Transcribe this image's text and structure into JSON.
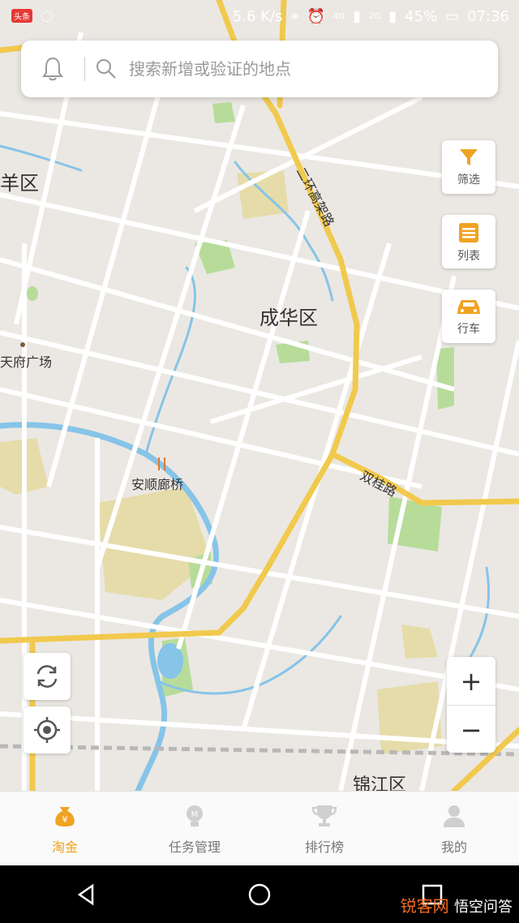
{
  "status_bar": {
    "speed": "5.6 K/s",
    "network1": "4G",
    "network2": "2G",
    "battery": "45%",
    "time": "07:36",
    "badge": "头条"
  },
  "search": {
    "placeholder": "搜索新增或验证的地点"
  },
  "map": {
    "labels": {
      "district1": "羊区",
      "district2": "成华区",
      "district3": "锦江区",
      "road1": "二环高架路",
      "road2": "双桂路",
      "poi1": "天府广场",
      "poi2": "安顺廊桥"
    }
  },
  "side_buttons": {
    "filter": "筛选",
    "list": "列表",
    "drive": "行车"
  },
  "tabs": [
    {
      "label": "淘金"
    },
    {
      "label": "任务管理"
    },
    {
      "label": "排行榜"
    },
    {
      "label": "我的"
    }
  ],
  "watermark": {
    "main": "锐客网",
    "sub": "悟空问答"
  },
  "colors": {
    "accent": "#f0a322",
    "road_major": "#f1c94d",
    "water": "#86c4e8",
    "park": "#b7dc9a"
  }
}
